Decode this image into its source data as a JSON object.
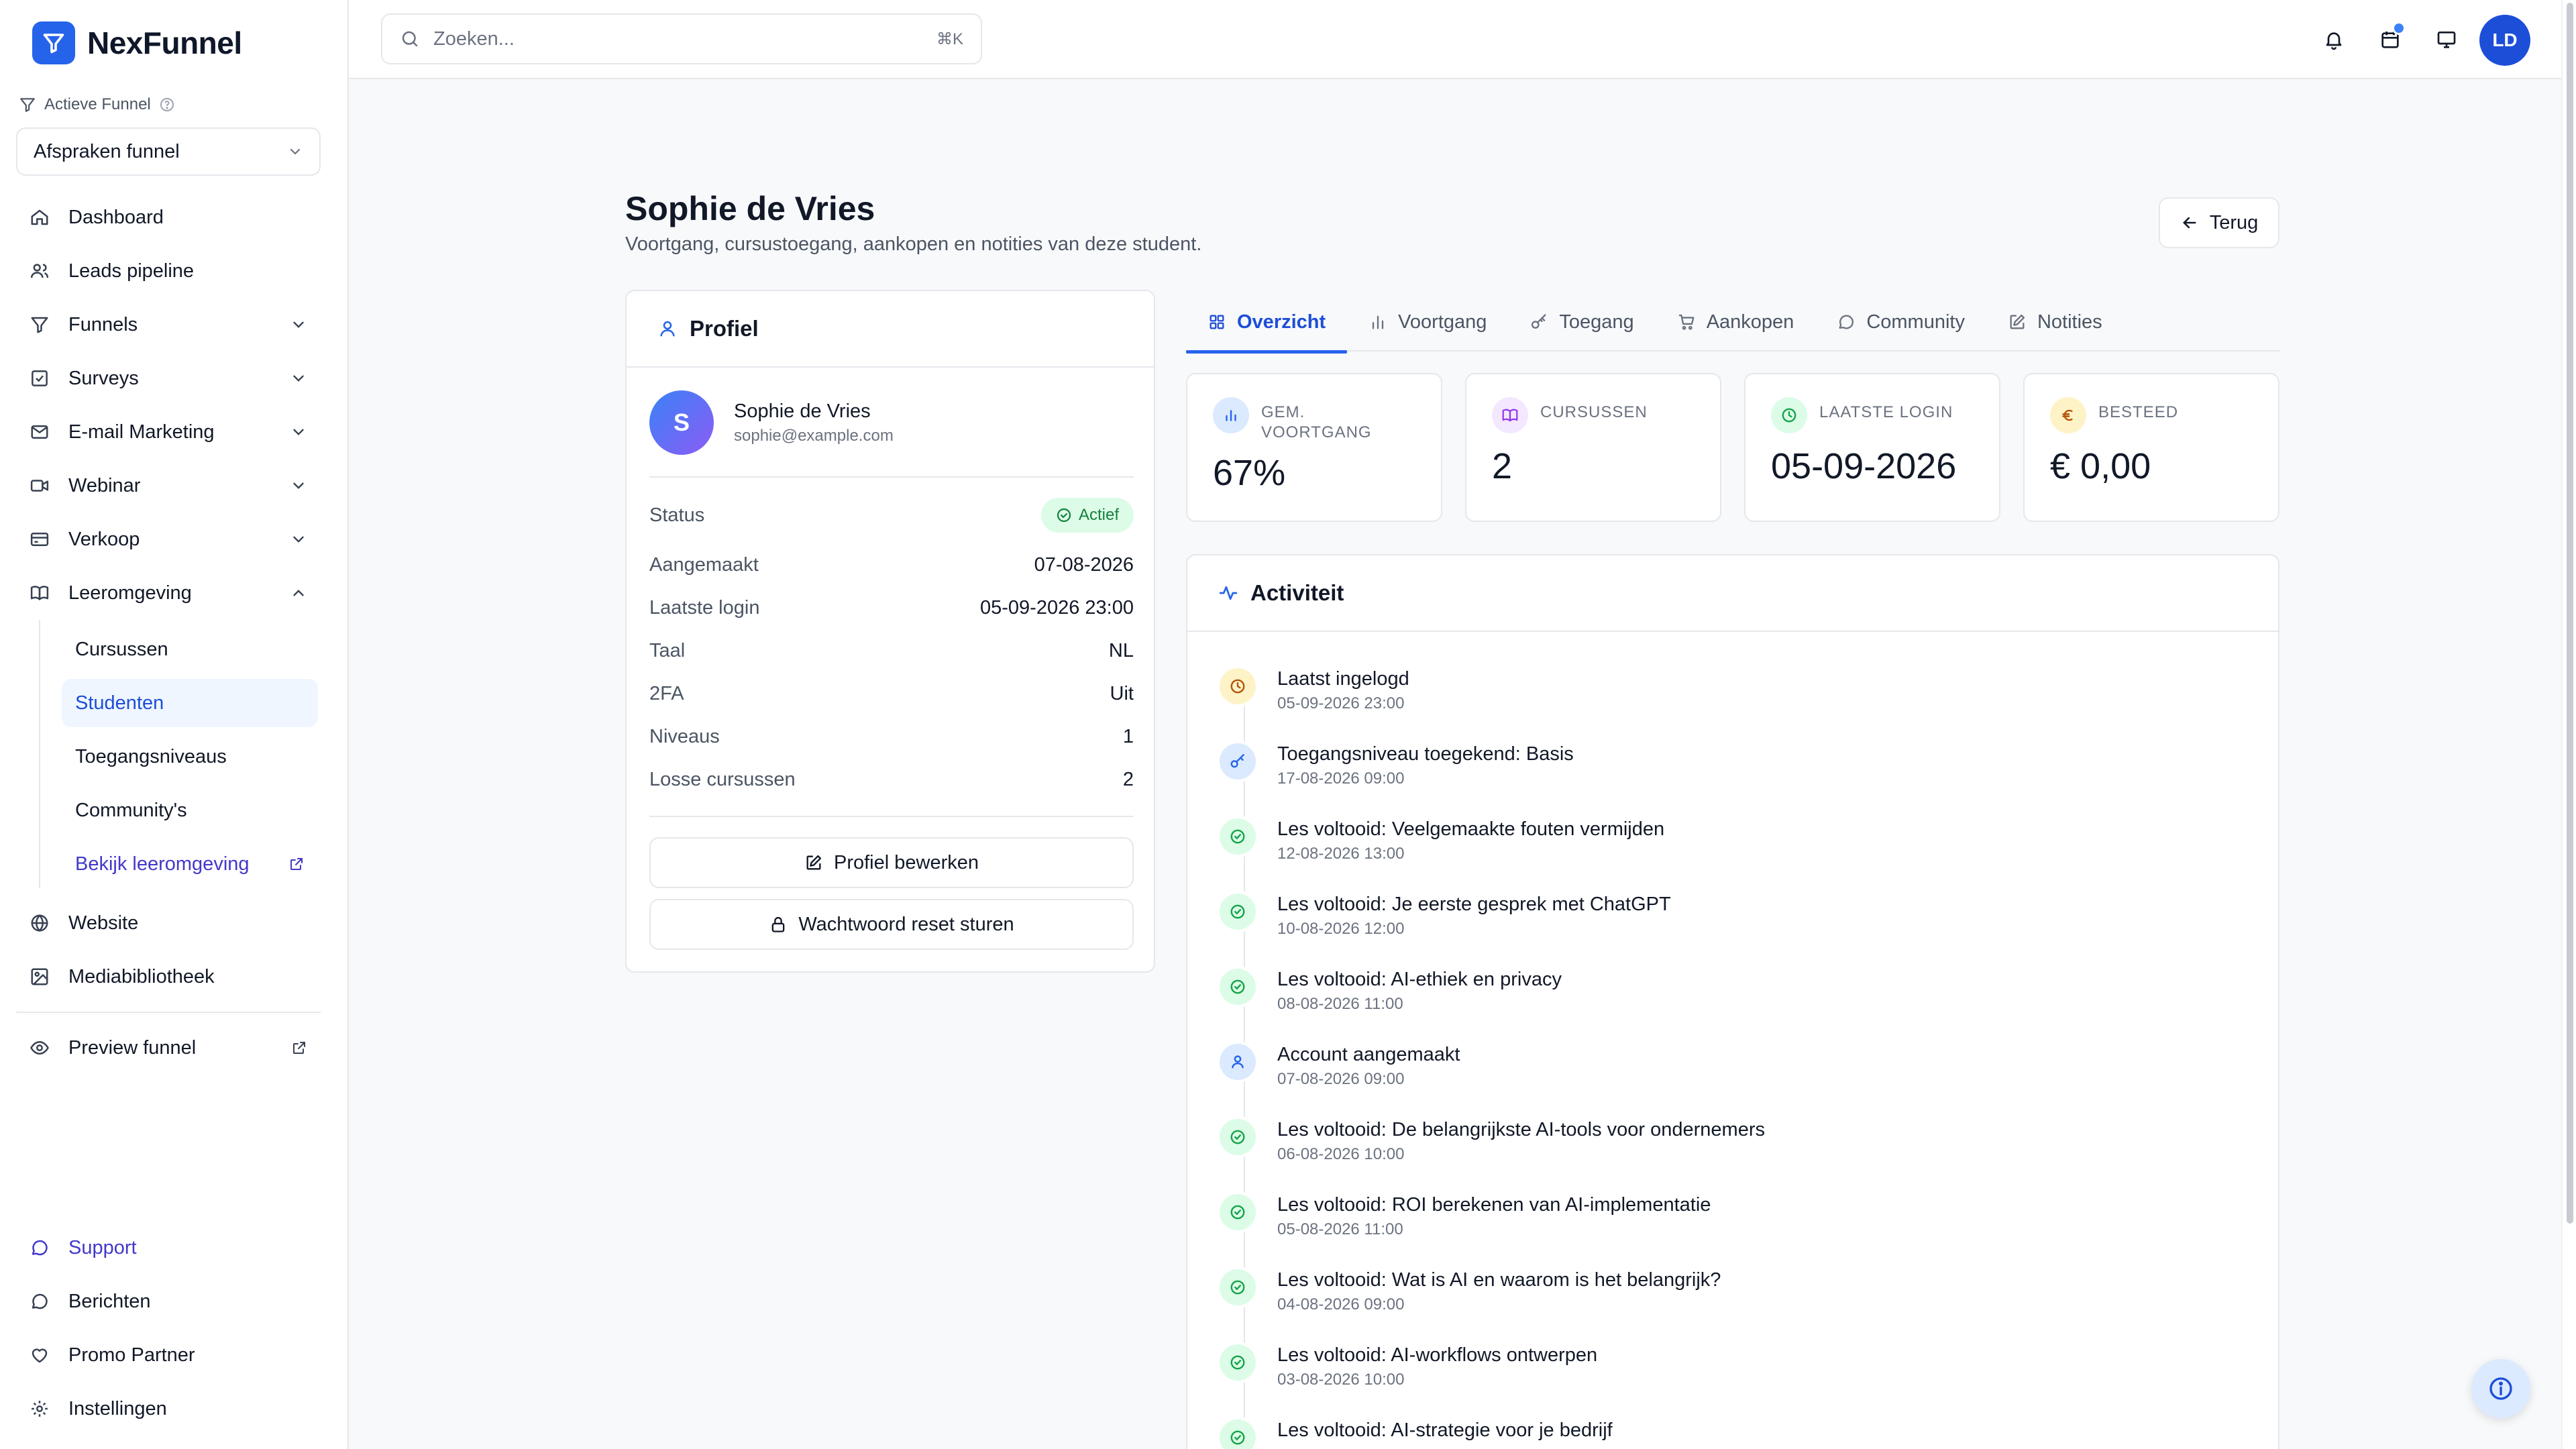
{
  "app": {
    "name": "NexFunnel",
    "brand_color": "#2563eb"
  },
  "sidebar": {
    "active_funnel_label": "Actieve Funnel",
    "active_funnel_value": "Afspraken funnel",
    "items": [
      {
        "label": "Dashboard",
        "icon": "home-icon"
      },
      {
        "label": "Leads pipeline",
        "icon": "users-icon"
      },
      {
        "label": "Funnels",
        "icon": "funnel-icon"
      },
      {
        "label": "Surveys",
        "icon": "checkbox-icon"
      },
      {
        "label": "E-mail Marketing",
        "icon": "mail-icon"
      },
      {
        "label": "Webinar",
        "icon": "video-icon"
      },
      {
        "label": "Verkoop",
        "icon": "card-icon"
      },
      {
        "label": "Leeromgeving",
        "icon": "book-icon"
      }
    ],
    "sub_items": [
      "Cursussen",
      "Studenten",
      "Toegangsniveaus",
      "Community's",
      "Bekijk leeromgeving"
    ],
    "items_after": [
      {
        "label": "Website",
        "icon": "globe-icon"
      },
      {
        "label": "Mediabibliotheek",
        "icon": "image-icon"
      },
      {
        "label": "Preview funnel",
        "icon": "eye-icon"
      }
    ],
    "bottom": [
      "Support",
      "Berichten",
      "Promo Partner",
      "Instellingen"
    ]
  },
  "topbar": {
    "search_placeholder": "Zoeken...",
    "shortcut": "⌘K",
    "avatar_initials": "LD"
  },
  "page": {
    "title": "Sophie de Vries",
    "subtitle": "Voortgang, cursustoegang, aankopen en notities van deze student.",
    "back_label": "Terug"
  },
  "profile": {
    "heading": "Profiel",
    "initial": "S",
    "name": "Sophie de Vries",
    "email": "sophie@example.com",
    "status_label": "Status",
    "status_value": "Actief",
    "rows": [
      {
        "k": "Aangemaakt",
        "v": "07-08-2026"
      },
      {
        "k": "Laatste login",
        "v": "05-09-2026 23:00"
      },
      {
        "k": "Taal",
        "v": "NL"
      },
      {
        "k": "2FA",
        "v": "Uit"
      },
      {
        "k": "Niveaus",
        "v": "1"
      },
      {
        "k": "Losse cursussen",
        "v": "2"
      }
    ],
    "edit_label": "Profiel bewerken",
    "reset_label": "Wachtwoord reset sturen"
  },
  "tabs": [
    "Overzicht",
    "Voortgang",
    "Toegang",
    "Aankopen",
    "Community",
    "Notities"
  ],
  "stats": [
    {
      "label_1": "GEM.",
      "label_2": "VOORTGANG",
      "value": "67%"
    },
    {
      "label_1": "CURSUSSEN",
      "label_2": "",
      "value": "2"
    },
    {
      "label_1": "LAATSTE LOGIN",
      "label_2": "",
      "value": "05-09-2026"
    },
    {
      "label_1": "BESTEED",
      "label_2": "",
      "value": "€ 0,00"
    }
  ],
  "activity": {
    "heading": "Activiteit",
    "items": [
      {
        "title": "Laatst ingelogd",
        "date": "05-09-2026 23:00",
        "kind": "clock"
      },
      {
        "title": "Toegangsniveau toegekend: Basis",
        "date": "17-08-2026 09:00",
        "kind": "key"
      },
      {
        "title": "Les voltooid: Veelgemaakte fouten vermijden",
        "date": "12-08-2026 13:00",
        "kind": "check"
      },
      {
        "title": "Les voltooid: Je eerste gesprek met ChatGPT",
        "date": "10-08-2026 12:00",
        "kind": "check"
      },
      {
        "title": "Les voltooid: AI-ethiek en privacy",
        "date": "08-08-2026 11:00",
        "kind": "check"
      },
      {
        "title": "Account aangemaakt",
        "date": "07-08-2026 09:00",
        "kind": "user"
      },
      {
        "title": "Les voltooid: De belangrijkste AI-tools voor ondernemers",
        "date": "06-08-2026 10:00",
        "kind": "check"
      },
      {
        "title": "Les voltooid: ROI berekenen van AI-implementatie",
        "date": "05-08-2026 11:00",
        "kind": "check"
      },
      {
        "title": "Les voltooid: Wat is AI en waarom is het belangrijk?",
        "date": "04-08-2026 09:00",
        "kind": "check"
      },
      {
        "title": "Les voltooid: AI-workflows ontwerpen",
        "date": "03-08-2026 10:00",
        "kind": "check"
      },
      {
        "title": "Les voltooid: AI-strategie voor je bedrijf",
        "date": "",
        "kind": "check"
      }
    ]
  }
}
